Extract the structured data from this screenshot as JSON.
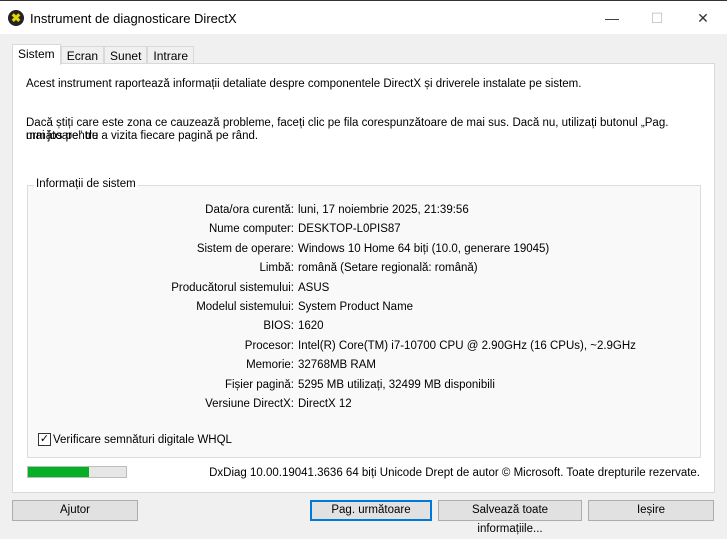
{
  "window": {
    "title": "Instrument de diagnosticare DirectX",
    "minimize": "—",
    "maximize": "☐",
    "close": "✕"
  },
  "tabs": [
    "Sistem",
    "Ecran",
    "Sunet",
    "Intrare"
  ],
  "intro": "Acest instrument raportează informații detaliate despre componentele DirectX și driverele instalate pe sistem.",
  "help_line1": "Dacă știți care este zona ce cauzează probleme, faceți clic pe fila corespunzătoare de mai sus. Dacă nu, utilizați butonul „Pag. următoare” de",
  "help_line2": "mai jos pentru a vizita fiecare pagină pe rând.",
  "group": {
    "title": "Informații de sistem",
    "rows": [
      {
        "k": "Data/ora curentă:",
        "v": "luni, 17 noiembrie 2025, 21:39:56"
      },
      {
        "k": "Nume computer:",
        "v": "DESKTOP-L0PIS87"
      },
      {
        "k": "Sistem de operare:",
        "v": "Windows 10 Home 64 biți (10.0, generare 19045)"
      },
      {
        "k": "Limbă:",
        "v": "română (Setare regională: română)"
      },
      {
        "k": "Producătorul sistemului:",
        "v": "ASUS"
      },
      {
        "k": "Modelul sistemului:",
        "v": "System Product Name"
      },
      {
        "k": "BIOS:",
        "v": "1620"
      },
      {
        "k": "Procesor:",
        "v": "Intel(R) Core(TM) i7-10700 CPU @ 2.90GHz (16 CPUs), ~2.9GHz"
      },
      {
        "k": "Memorie:",
        "v": "32768MB RAM"
      },
      {
        "k": "Fișier pagină:",
        "v": "5295 MB utilizați, 32499 MB disponibili"
      },
      {
        "k": "Versiune DirectX:",
        "v": "DirectX 12"
      }
    ]
  },
  "whql": {
    "label": "Verificare semnături digitale WHQL",
    "checked": true
  },
  "progress_percent": 62,
  "copyright": "DxDiag 10.00.19041.3636 64 biți Unicode  Drept de autor © Microsoft. Toate drepturile rezervate.",
  "buttons": {
    "help": "Ajutor",
    "next": "Pag. următoare",
    "save": "Salvează toate informațiile...",
    "exit": "Ieșire"
  }
}
